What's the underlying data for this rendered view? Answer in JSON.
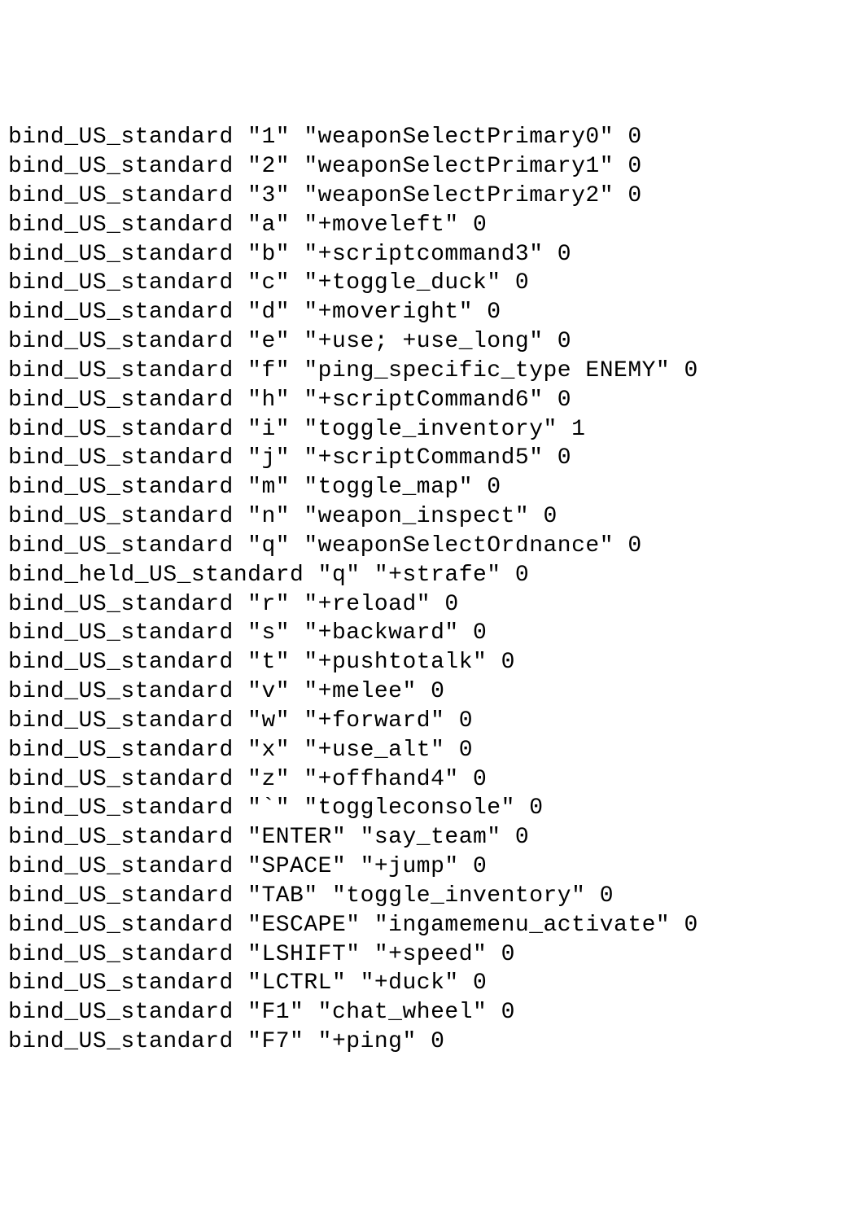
{
  "binds": [
    {
      "cmd": "bind_US_standard",
      "key": "1",
      "action": "weaponSelectPrimary0",
      "flag": "0"
    },
    {
      "cmd": "bind_US_standard",
      "key": "2",
      "action": "weaponSelectPrimary1",
      "flag": "0"
    },
    {
      "cmd": "bind_US_standard",
      "key": "3",
      "action": "weaponSelectPrimary2",
      "flag": "0"
    },
    {
      "cmd": "bind_US_standard",
      "key": "a",
      "action": "+moveleft",
      "flag": "0"
    },
    {
      "cmd": "bind_US_standard",
      "key": "b",
      "action": "+scriptcommand3",
      "flag": "0"
    },
    {
      "cmd": "bind_US_standard",
      "key": "c",
      "action": "+toggle_duck",
      "flag": "0"
    },
    {
      "cmd": "bind_US_standard",
      "key": "d",
      "action": "+moveright",
      "flag": "0"
    },
    {
      "cmd": "bind_US_standard",
      "key": "e",
      "action": "+use; +use_long",
      "flag": "0"
    },
    {
      "cmd": "bind_US_standard",
      "key": "f",
      "action": "ping_specific_type ENEMY",
      "flag": "0"
    },
    {
      "cmd": "bind_US_standard",
      "key": "h",
      "action": "+scriptCommand6",
      "flag": "0"
    },
    {
      "cmd": "bind_US_standard",
      "key": "i",
      "action": "toggle_inventory",
      "flag": "1"
    },
    {
      "cmd": "bind_US_standard",
      "key": "j",
      "action": "+scriptCommand5",
      "flag": "0"
    },
    {
      "cmd": "bind_US_standard",
      "key": "m",
      "action": "toggle_map",
      "flag": "0"
    },
    {
      "cmd": "bind_US_standard",
      "key": "n",
      "action": "weapon_inspect",
      "flag": "0"
    },
    {
      "cmd": "bind_US_standard",
      "key": "q",
      "action": "weaponSelectOrdnance",
      "flag": "0"
    },
    {
      "cmd": "bind_held_US_standard",
      "key": "q",
      "action": "+strafe",
      "flag": "0"
    },
    {
      "cmd": "bind_US_standard",
      "key": "r",
      "action": "+reload",
      "flag": "0"
    },
    {
      "cmd": "bind_US_standard",
      "key": "s",
      "action": "+backward",
      "flag": "0"
    },
    {
      "cmd": "bind_US_standard",
      "key": "t",
      "action": "+pushtotalk",
      "flag": "0"
    },
    {
      "cmd": "bind_US_standard",
      "key": "v",
      "action": "+melee",
      "flag": "0"
    },
    {
      "cmd": "bind_US_standard",
      "key": "w",
      "action": "+forward",
      "flag": "0"
    },
    {
      "cmd": "bind_US_standard",
      "key": "x",
      "action": "+use_alt",
      "flag": "0"
    },
    {
      "cmd": "bind_US_standard",
      "key": "z",
      "action": "+offhand4",
      "flag": "0"
    },
    {
      "cmd": "bind_US_standard",
      "key": "`",
      "action": "toggleconsole",
      "flag": "0"
    },
    {
      "cmd": "bind_US_standard",
      "key": "ENTER",
      "action": "say_team",
      "flag": "0"
    },
    {
      "cmd": "bind_US_standard",
      "key": "SPACE",
      "action": "+jump",
      "flag": "0"
    },
    {
      "cmd": "bind_US_standard",
      "key": "TAB",
      "action": "toggle_inventory",
      "flag": "0"
    },
    {
      "cmd": "bind_US_standard",
      "key": "ESCAPE",
      "action": "ingamemenu_activate",
      "flag": "0"
    },
    {
      "cmd": "bind_US_standard",
      "key": "LSHIFT",
      "action": "+speed",
      "flag": "0"
    },
    {
      "cmd": "bind_US_standard",
      "key": "LCTRL",
      "action": "+duck",
      "flag": "0"
    },
    {
      "cmd": "bind_US_standard",
      "key": "F1",
      "action": "chat_wheel",
      "flag": "0"
    },
    {
      "cmd": "bind_US_standard",
      "key": "F7",
      "action": "+ping",
      "flag": "0"
    }
  ]
}
